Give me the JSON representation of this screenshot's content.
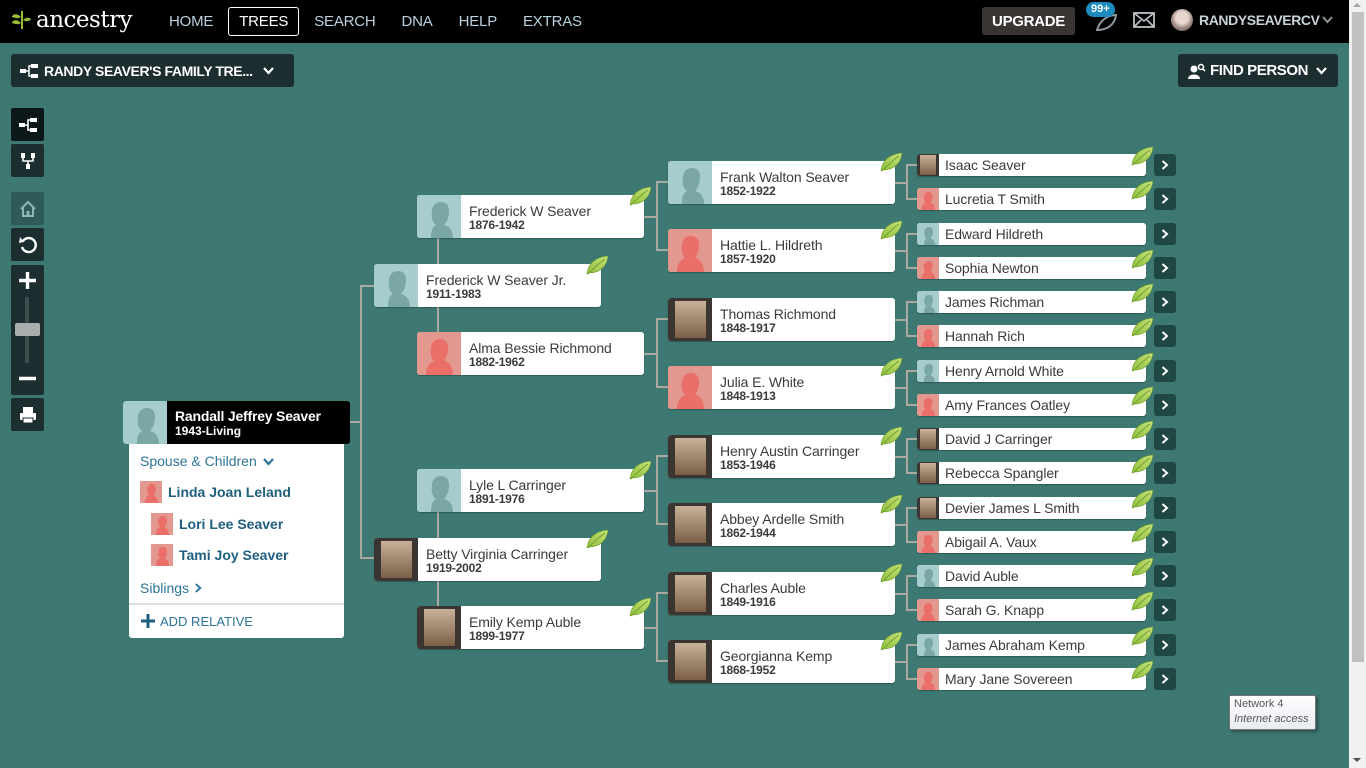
{
  "nav": {
    "logo_text": "ancestry",
    "links": [
      {
        "label": "HOME",
        "active": false
      },
      {
        "label": "TREES",
        "active": true
      },
      {
        "label": "SEARCH",
        "active": false
      },
      {
        "label": "DNA",
        "active": false
      },
      {
        "label": "HELP",
        "active": false
      },
      {
        "label": "EXTRAS",
        "active": false
      }
    ],
    "upgrade_label": "UPGRADE",
    "hints_badge": "99+",
    "hints_icon": "leaf-hint-icon",
    "messages_icon": "envelope-icon",
    "username": "RANDYSEAVERCV"
  },
  "toolbar": {
    "tree_name": "RANDY SEAVER'S FAMILY TRE...",
    "find_person_label": "FIND PERSON",
    "zoom_level": 0.5
  },
  "colors": {
    "background": "#3d7873",
    "male_placeholder": "#a7cccd",
    "female_placeholder": "#e2988f",
    "link": "#1e5e7f",
    "hint_badge": "#1d8bc0"
  },
  "root_person": {
    "name": "Randall Jeffrey Seaver",
    "dates": "1943-Living",
    "gender": "male"
  },
  "family_panel": {
    "spouse_children_label": "Spouse & Children",
    "spouse": {
      "name": "Linda Joan Leland"
    },
    "children": [
      {
        "name": "Lori Lee Seaver"
      },
      {
        "name": "Tami Joy Seaver"
      }
    ],
    "siblings_label": "Siblings",
    "add_relative_label": "ADD RELATIVE"
  },
  "parents": [
    {
      "name": "Frederick W Seaver Jr.",
      "dates": "1911-1983",
      "gender": "male",
      "photo": false,
      "hint": true
    },
    {
      "name": "Betty Virginia Carringer",
      "dates": "1919-2002",
      "gender": "female",
      "photo": true,
      "hint": true
    }
  ],
  "grandparents": [
    {
      "name": "Frederick W Seaver",
      "dates": "1876-1942",
      "gender": "male",
      "photo": false,
      "hint": true
    },
    {
      "name": "Alma Bessie Richmond",
      "dates": "1882-1962",
      "gender": "female",
      "photo": false,
      "hint": false
    },
    {
      "name": "Lyle L Carringer",
      "dates": "1891-1976",
      "gender": "male",
      "photo": false,
      "hint": true
    },
    {
      "name": "Emily Kemp Auble",
      "dates": "1899-1977",
      "gender": "female",
      "photo": true,
      "hint": true
    }
  ],
  "great_grandparents": [
    {
      "name": "Frank Walton Seaver",
      "dates": "1852-1922",
      "gender": "male",
      "photo": false,
      "hint": true
    },
    {
      "name": "Hattie L. Hildreth",
      "dates": "1857-1920",
      "gender": "female",
      "photo": false,
      "hint": true
    },
    {
      "name": "Thomas Richmond",
      "dates": "1848-1917",
      "gender": "male",
      "photo": true,
      "hint": false
    },
    {
      "name": "Julia E. White",
      "dates": "1848-1913",
      "gender": "female",
      "photo": false,
      "hint": true
    },
    {
      "name": "Henry Austin Carringer",
      "dates": "1853-1946",
      "gender": "male",
      "photo": true,
      "hint": true
    },
    {
      "name": "Abbey Ardelle Smith",
      "dates": "1862-1944",
      "gender": "female",
      "photo": true,
      "hint": true
    },
    {
      "name": "Charles Auble",
      "dates": "1849-1916",
      "gender": "male",
      "photo": true,
      "hint": true
    },
    {
      "name": "Georgianna Kemp",
      "dates": "1868-1952",
      "gender": "female",
      "photo": true,
      "hint": true
    }
  ],
  "gg_grandparents": [
    {
      "name": "Isaac Seaver",
      "gender": "male",
      "photo": true,
      "hint": true
    },
    {
      "name": "Lucretia T Smith",
      "gender": "female",
      "photo": false,
      "hint": true
    },
    {
      "name": "Edward Hildreth",
      "gender": "male",
      "photo": false,
      "hint": false
    },
    {
      "name": "Sophia Newton",
      "gender": "female",
      "photo": false,
      "hint": true
    },
    {
      "name": "James Richman",
      "gender": "male",
      "photo": false,
      "hint": true
    },
    {
      "name": "Hannah Rich",
      "gender": "female",
      "photo": false,
      "hint": true
    },
    {
      "name": "Henry Arnold White",
      "gender": "male",
      "photo": false,
      "hint": true
    },
    {
      "name": "Amy Frances Oatley",
      "gender": "female",
      "photo": false,
      "hint": true
    },
    {
      "name": "David J Carringer",
      "gender": "male",
      "photo": true,
      "hint": true
    },
    {
      "name": "Rebecca Spangler",
      "gender": "female",
      "photo": true,
      "hint": true
    },
    {
      "name": "Devier James L Smith",
      "gender": "male",
      "photo": true,
      "hint": true
    },
    {
      "name": "Abigail A. Vaux",
      "gender": "female",
      "photo": false,
      "hint": true
    },
    {
      "name": "David Auble",
      "gender": "male",
      "photo": false,
      "hint": true
    },
    {
      "name": "Sarah G. Knapp",
      "gender": "female",
      "photo": false,
      "hint": true
    },
    {
      "name": "James Abraham Kemp",
      "gender": "male",
      "photo": false,
      "hint": true
    },
    {
      "name": "Mary Jane Sovereen",
      "gender": "female",
      "photo": false,
      "hint": true
    }
  ],
  "tooltip": {
    "line1": "Network  4",
    "line2": "Internet access"
  }
}
